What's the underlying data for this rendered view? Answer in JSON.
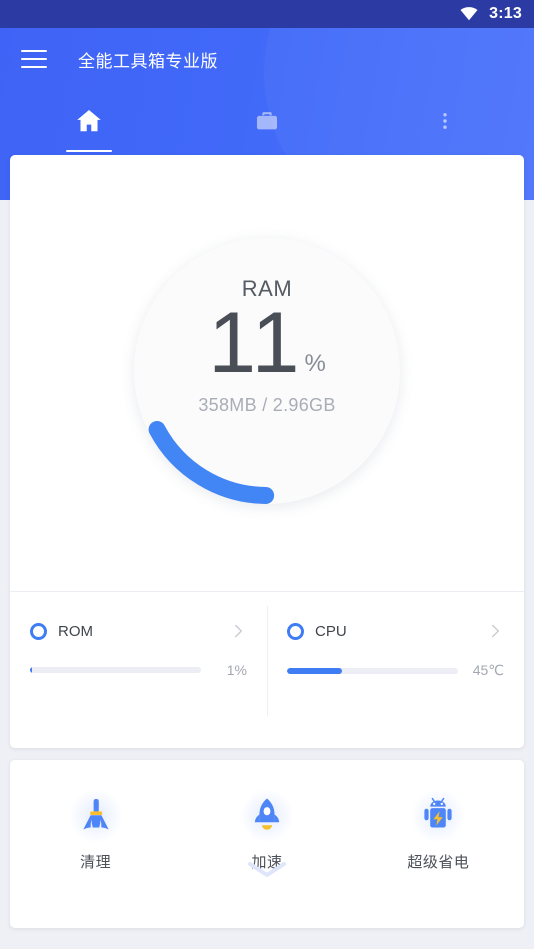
{
  "statusbar": {
    "time": "3:13",
    "wifi_icon": "wifi-icon"
  },
  "appbar": {
    "title": "全能工具箱专业版",
    "menu_icon": "hamburger-menu-icon",
    "brand_color": "#4169f8",
    "tabs": [
      {
        "icon": "home-icon",
        "name": "home",
        "selected": true
      },
      {
        "icon": "toolbox-icon",
        "name": "toolbox",
        "selected": false
      },
      {
        "icon": "overflow-menu-icon",
        "name": "overflow",
        "selected": false
      }
    ]
  },
  "gauge": {
    "label": "RAM",
    "value": "11",
    "unit": "%",
    "percent": 11,
    "detail": "358MB / 2.96GB",
    "used": "358MB",
    "total": "2.96GB",
    "arc_color": "#4285f4",
    "track_color": "#fbfbfc"
  },
  "stats": [
    {
      "name": "ROM",
      "value": "1%",
      "percent": 1,
      "dot_color": "#3f7df4",
      "chevron_icon": "chevron-right-icon"
    },
    {
      "name": "CPU",
      "value": "45℃",
      "percent": 32,
      "dot_color": "#3f7df4",
      "chevron_icon": "chevron-right-icon"
    }
  ],
  "tools": [
    {
      "label": "清理",
      "icon": "broom-icon"
    },
    {
      "label": "加速",
      "icon": "rocket-icon"
    },
    {
      "label": "超级省电",
      "icon": "battery-robot-icon"
    }
  ],
  "pull_indicator": {
    "icon": "chevron-down-icon"
  }
}
